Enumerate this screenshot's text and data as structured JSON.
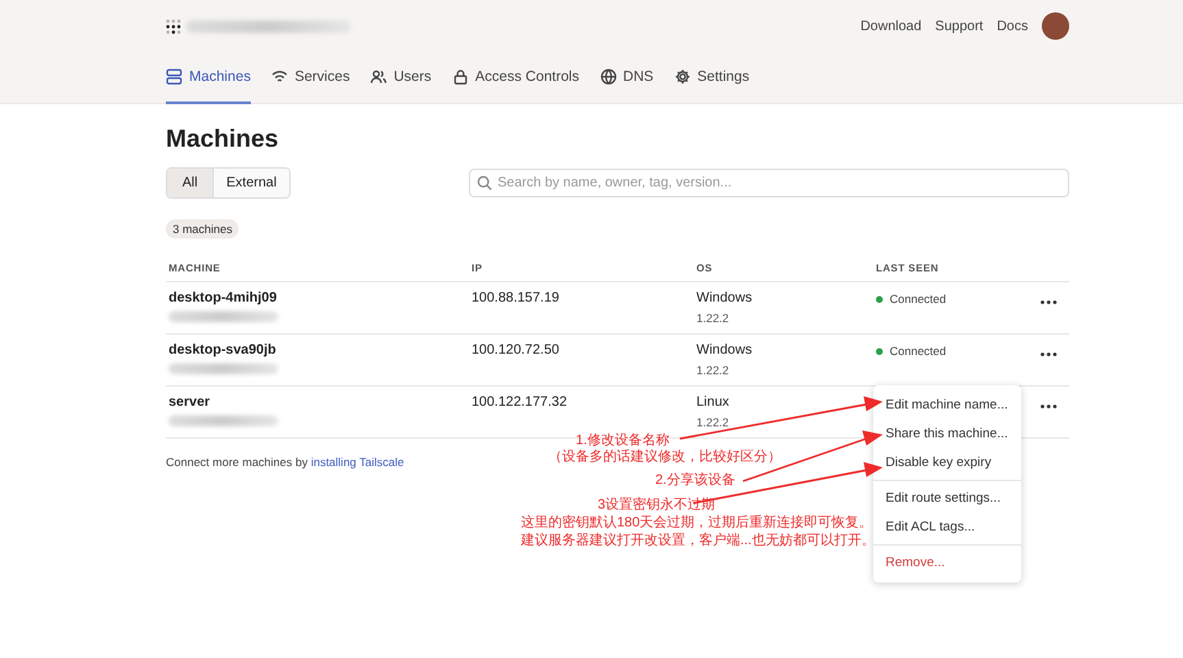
{
  "header": {
    "links": [
      "Download",
      "Support",
      "Docs"
    ]
  },
  "tabs": [
    {
      "label": "Machines",
      "selected": true
    },
    {
      "label": "Services",
      "selected": false
    },
    {
      "label": "Users",
      "selected": false
    },
    {
      "label": "Access Controls",
      "selected": false
    },
    {
      "label": "DNS",
      "selected": false
    },
    {
      "label": "Settings",
      "selected": false
    }
  ],
  "page_title": "Machines",
  "filters": [
    {
      "label": "All",
      "selected": true
    },
    {
      "label": "External",
      "selected": false
    }
  ],
  "search": {
    "placeholder": "Search by name, owner, tag, version..."
  },
  "count_badge": "3 machines",
  "table": {
    "columns": [
      "MACHINE",
      "IP",
      "OS",
      "LAST SEEN"
    ],
    "rows": [
      {
        "name": "desktop-4mihj09",
        "ip": "100.88.157.19",
        "os": "Windows",
        "version": "1.22.2",
        "last_seen": "Connected",
        "connected": true
      },
      {
        "name": "desktop-sva90jb",
        "ip": "100.120.72.50",
        "os": "Windows",
        "version": "1.22.2",
        "last_seen": "Connected",
        "connected": true
      },
      {
        "name": "server",
        "ip": "100.122.177.32",
        "os": "Linux",
        "version": "1.22.2"
      }
    ]
  },
  "footer": {
    "text": "Connect more machines by ",
    "link": "installing Tailscale"
  },
  "menu": {
    "groups": [
      [
        {
          "label": "Edit machine name...",
          "kind": "action"
        },
        {
          "label": "Share this machine...",
          "kind": "action"
        },
        {
          "label": "Disable key expiry",
          "kind": "action"
        }
      ],
      [
        {
          "label": "Edit route settings...",
          "kind": "action"
        },
        {
          "label": "Edit ACL tags...",
          "kind": "action"
        }
      ],
      [
        {
          "label": "Remove...",
          "kind": "danger"
        }
      ]
    ]
  },
  "annotations": [
    "1.修改设备名称",
    "（设备多的话建议修改，比较好区分）",
    "2.分享该设备",
    "3设置密钥永不过期",
    "这里的密钥默认180天会过期，过期后重新连接即可恢复。",
    "建议服务器建议打开改设置，客户端...也无妨都可以打开。"
  ]
}
